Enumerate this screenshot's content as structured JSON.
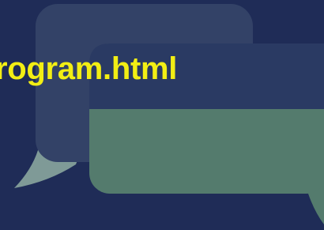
{
  "file_label": "rogram.html",
  "icon": "chat-bubbles-icon",
  "colors": {
    "background": "#1f2c57",
    "back_bubble": "#334267",
    "back_bubble_tail": "#7f9a97",
    "front_bubble": "#547b6d",
    "front_bubble_top": "#2a3a63",
    "label": "#f2ee14"
  }
}
